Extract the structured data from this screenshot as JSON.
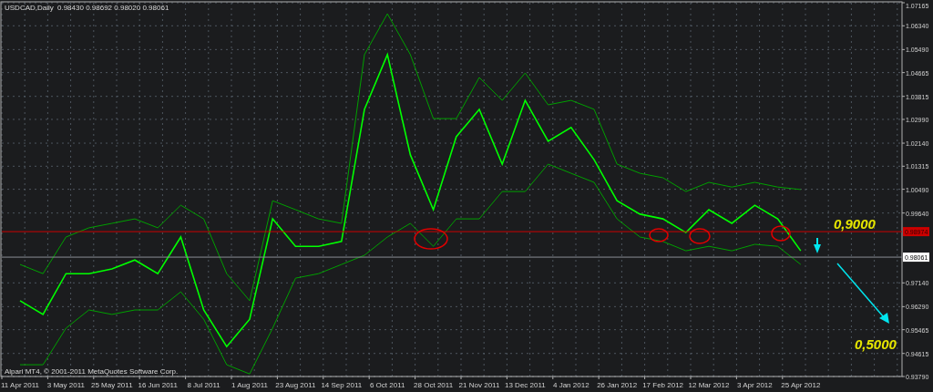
{
  "chart": {
    "symbol": "USDCAD,Daily",
    "ohlc": "0.98430 0.98692 0.98020 0.98061",
    "copyright": "Alpari MT4, © 2001-2011 MetaQuotes Software Corp.",
    "chart_data": {
      "type": "line",
      "categories": [
        "11 Apr 2011",
        null,
        "3 May 2011",
        null,
        "25 May 2011",
        null,
        "16 Jun 2011",
        null,
        "8 Jul 2011",
        null,
        "1 Aug 2011",
        null,
        "23 Aug 2011",
        null,
        "14 Sep 2011",
        null,
        "6 Oct 2011",
        null,
        "28 Oct 2011",
        null,
        "21 Nov 2011",
        null,
        "13 Dec 2011",
        null,
        "4 Jan 2012",
        null,
        "26 Jan 2012",
        null,
        "17 Feb 2012",
        null,
        "12 Mar 2012",
        null,
        "3 Apr 2012",
        null,
        "25 Apr 2012"
      ],
      "series": [
        {
          "color": "#00ff00",
          "values": [
            0.965,
            0.9601,
            0.9747,
            0.9747,
            0.9764,
            0.9796,
            0.9747,
            0.9878,
            0.9617,
            0.9486,
            0.9584,
            0.9943,
            0.9845,
            0.9845,
            0.9862,
            1.0335,
            1.0531,
            1.0172,
            0.9976,
            1.0237,
            1.0335,
            1.0139,
            1.0367,
            1.0221,
            1.027,
            1.0155,
            1.0008,
            0.996,
            0.9943,
            0.9894,
            0.9976,
            0.9927,
            0.9992,
            0.9943,
            0.9829
          ]
        },
        {
          "color": "#00a000",
          "values": [
            0.978,
            0.9747,
            0.9878,
            0.9911,
            0.9927,
            0.9943,
            0.9911,
            0.9992,
            0.9943,
            0.9747,
            0.965,
            1.0008,
            0.9976,
            0.9943,
            0.9927,
            1.0531,
            1.0677,
            1.0531,
            1.0302,
            1.0302,
            1.0449,
            1.0367,
            1.0465,
            1.0351,
            1.0367,
            1.0335,
            1.0139,
            1.0106,
            1.009,
            1.0041,
            1.0074,
            1.0057,
            1.0074,
            1.0057,
            1.0048
          ]
        },
        {
          "color": "#00a000",
          "values": [
            0.9421,
            0.9421,
            0.9552,
            0.9617,
            0.9601,
            0.9617,
            0.9617,
            0.9682,
            0.9584,
            0.9421,
            0.9388,
            0.9552,
            0.9731,
            0.9747,
            0.978,
            0.9813,
            0.9878,
            0.9927,
            0.9845,
            0.9943,
            0.9943,
            1.0041,
            1.0041,
            1.0139,
            1.0106,
            1.0074,
            0.9943,
            0.9878,
            0.9862,
            0.9829,
            0.9845,
            0.9829,
            0.9852,
            0.9845,
            0.978
          ]
        }
      ],
      "ylim": [
        0.9379,
        1.07165
      ],
      "yticks": [
        {
          "value": 1.07165,
          "label": "1.07165"
        },
        {
          "value": 1.0634,
          "label": "1.06340"
        },
        {
          "value": 1.0549,
          "label": "1.05490"
        },
        {
          "value": 1.04665,
          "label": "1.04665"
        },
        {
          "value": 1.03815,
          "label": "1.03815"
        },
        {
          "value": 1.0299,
          "label": "1.02990"
        },
        {
          "value": 1.0214,
          "label": "1.02140"
        },
        {
          "value": 1.01315,
          "label": "1.01315"
        },
        {
          "value": 1.0049,
          "label": "1.00490"
        },
        {
          "value": 0.9964,
          "label": "0.99640"
        },
        {
          "value": 0.9714,
          "label": "0.97140"
        },
        {
          "value": 0.9629,
          "label": "0.96290"
        },
        {
          "value": 0.95465,
          "label": "0.95465"
        },
        {
          "value": 0.94615,
          "label": "0.94615"
        },
        {
          "value": 0.9379,
          "label": "0.93790"
        }
      ],
      "ref_lines": [
        {
          "axis": "y",
          "value": 0.98974,
          "label": "0.98974"
        },
        {
          "axis": "y",
          "value": 0.98061,
          "label": "0.98061"
        }
      ],
      "grid": true,
      "annotations": [
        "0,9000",
        "0,5000"
      ]
    }
  }
}
